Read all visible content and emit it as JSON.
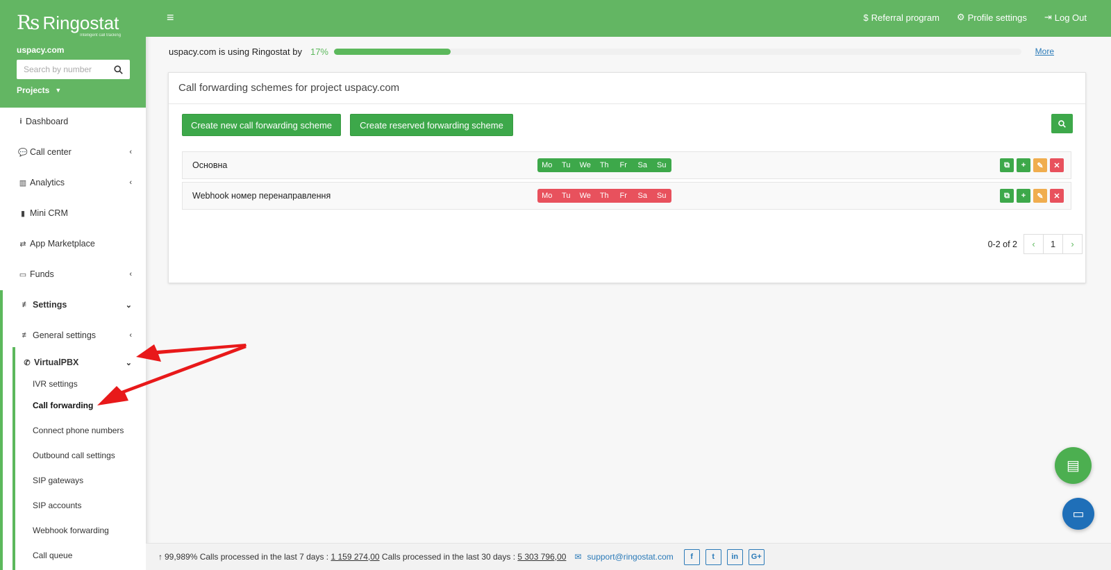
{
  "brand": {
    "logo_mark": "Rs",
    "name": "Ringostat",
    "tagline": "Intelligent call tracking",
    "project": "uspacy.com"
  },
  "sidebar": {
    "search_placeholder": "Search by number",
    "projects_label": "Projects",
    "items": [
      {
        "label": "Dashboard",
        "icon": "info-icon"
      },
      {
        "label": "Call center",
        "icon": "comment-icon"
      },
      {
        "label": "Analytics",
        "icon": "bar-chart-icon"
      },
      {
        "label": "Mini CRM",
        "icon": "book-icon"
      },
      {
        "label": "App Marketplace",
        "icon": "exchange-icon"
      },
      {
        "label": "Funds",
        "icon": "credit-card-icon"
      },
      {
        "label": "Settings",
        "icon": "sliders-icon"
      },
      {
        "label": "General settings",
        "icon": "sliders-icon"
      },
      {
        "label": "VirtualPBX",
        "icon": "phone-icon"
      }
    ],
    "subitems": [
      "IVR settings",
      "Call forwarding",
      "Connect phone numbers",
      "Outbound call settings",
      "SIP gateways",
      "SIP accounts",
      "Webhook forwarding",
      "Call queue"
    ]
  },
  "topbar": {
    "referral": "Referral program",
    "profile": "Profile settings",
    "logout": "Log Out"
  },
  "usage": {
    "text": "uspacy.com is using Ringostat by",
    "percent_label": "17%",
    "percent": 17,
    "more": "More"
  },
  "panel": {
    "title": "Call forwarding schemes for project uspacy.com",
    "create_new": "Create new call forwarding scheme",
    "create_reserved": "Create reserved forwarding scheme",
    "days": [
      "Mo",
      "Tu",
      "We",
      "Th",
      "Fr",
      "Sa",
      "Su"
    ],
    "schemes": [
      {
        "name": "Основна",
        "status_color": "#3da84a"
      },
      {
        "name": "Webhook номер перенаправлення",
        "status_color": "#e8515d"
      }
    ],
    "pagination": {
      "range": "0-2 of 2",
      "page": "1"
    }
  },
  "footer": {
    "uptime": "99,989%",
    "calls7_label": "Calls processed in the last 7 days :",
    "calls7": "1 159 274,00",
    "calls30_label": "Calls processed in the last 30 days :",
    "calls30": "5 303 796,00",
    "email": "support@ringostat.com",
    "social": [
      "f",
      "t",
      "in",
      "G+"
    ]
  },
  "colors": {
    "brand_green": "#63b663",
    "button_green": "#3da84a",
    "danger": "#e8515d",
    "warning": "#f0ad4e",
    "link": "#2a7ab8"
  }
}
